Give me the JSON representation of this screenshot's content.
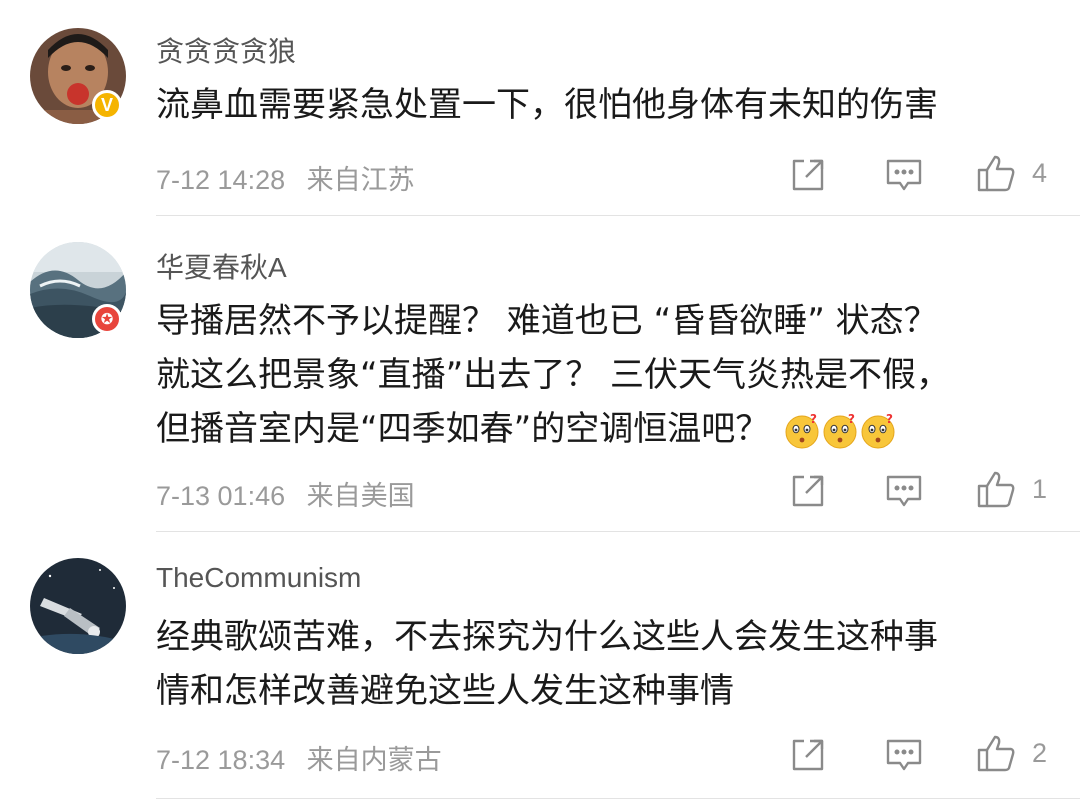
{
  "comments": [
    {
      "username": "贪贪贪贪狼",
      "lines": [
        "流鼻血需要紧急处置一下，很怕他身体有未知的伤害"
      ],
      "time": "7-12 14:28",
      "location": "来自江苏",
      "likes": "4",
      "badge": "V",
      "badge_color": "#f5b400"
    },
    {
      "username": "华夏春秋A",
      "lines": [
        "导播居然不予以提醒？ 难道也已 “昏昏欲睡” 状态？",
        "就这么把景象“直播”出去了？ 三伏天气炎热是不假，",
        "但播音室内是“四季如春”的空调恒温吧？"
      ],
      "emoji": [
        "confused-face-emoji",
        "confused-face-emoji",
        "confused-face-emoji"
      ],
      "time": "7-13 01:46",
      "location": "来自美国",
      "likes": "1",
      "badge_color": "#e8453c"
    },
    {
      "username": "TheCommunism",
      "lines": [
        "经典歌颂苦难，不去探究为什么这些人会发生这种事",
        "情和怎样改善避免这些人发生这种事情"
      ],
      "time": "7-12 18:34",
      "location": "来自内蒙古",
      "likes": "2"
    }
  ],
  "icons": {
    "share": "share-icon",
    "comment": "comment-icon",
    "like": "thumbs-up-icon"
  },
  "colors": {
    "meta_text": "#9a9a9a",
    "icon_stroke": "#8a8a8a",
    "verified_badge": "#f5b400",
    "member_badge": "#e8453c"
  }
}
